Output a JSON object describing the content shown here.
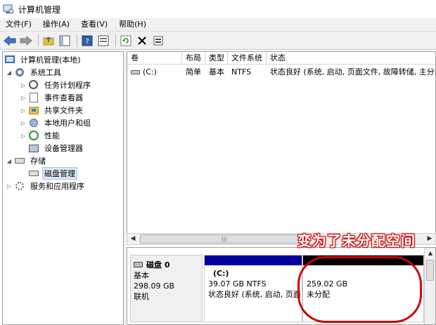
{
  "window": {
    "title": "计算机管理"
  },
  "menu": [
    {
      "label": "文件(F)"
    },
    {
      "label": "操作(A)"
    },
    {
      "label": "查看(V)"
    },
    {
      "label": "帮助(H)"
    }
  ],
  "toolbar": {
    "icons": [
      "back-arrow-icon",
      "forward-arrow-icon",
      "up-folder-icon",
      "show-tree-icon",
      "help-icon",
      "properties-icon",
      "refresh-icon",
      "delete-icon",
      "export-icon"
    ]
  },
  "tree": {
    "root": "计算机管理(本地)",
    "system_tools": "系统工具",
    "task_scheduler": "任务计划程序",
    "event_viewer": "事件查看器",
    "shared_folders": "共享文件夹",
    "local_users": "本地用户和组",
    "performance": "性能",
    "device_manager": "设备管理器",
    "storage": "存储",
    "disk_management": "磁盘管理",
    "services_apps": "服务和应用程序"
  },
  "volumes": {
    "columns": [
      "卷",
      "布局",
      "类型",
      "文件系统",
      "状态"
    ],
    "rows": [
      {
        "volume": "(C:)",
        "layout": "简单",
        "type": "基本",
        "fs": "NTFS",
        "status": "状态良好 (系统, 启动, 页面文件, 故障转储, 主分区"
      }
    ]
  },
  "disk": {
    "name": "磁盘 0",
    "type": "基本",
    "size": "298.09 GB",
    "state": "联机",
    "partitions": [
      {
        "name": "(C:)",
        "size_fs": "39.07 GB NTFS",
        "status": "状态良好 (系统, 启动, 页面"
      },
      {
        "size": "259.02 GB",
        "status": "未分配"
      }
    ]
  },
  "annotation": {
    "text": "变为了未分配空间"
  },
  "colors": {
    "primary_partition_bar": "#0000a0",
    "unallocated_bar": "#000000",
    "annotation_circle": "#d00000"
  }
}
